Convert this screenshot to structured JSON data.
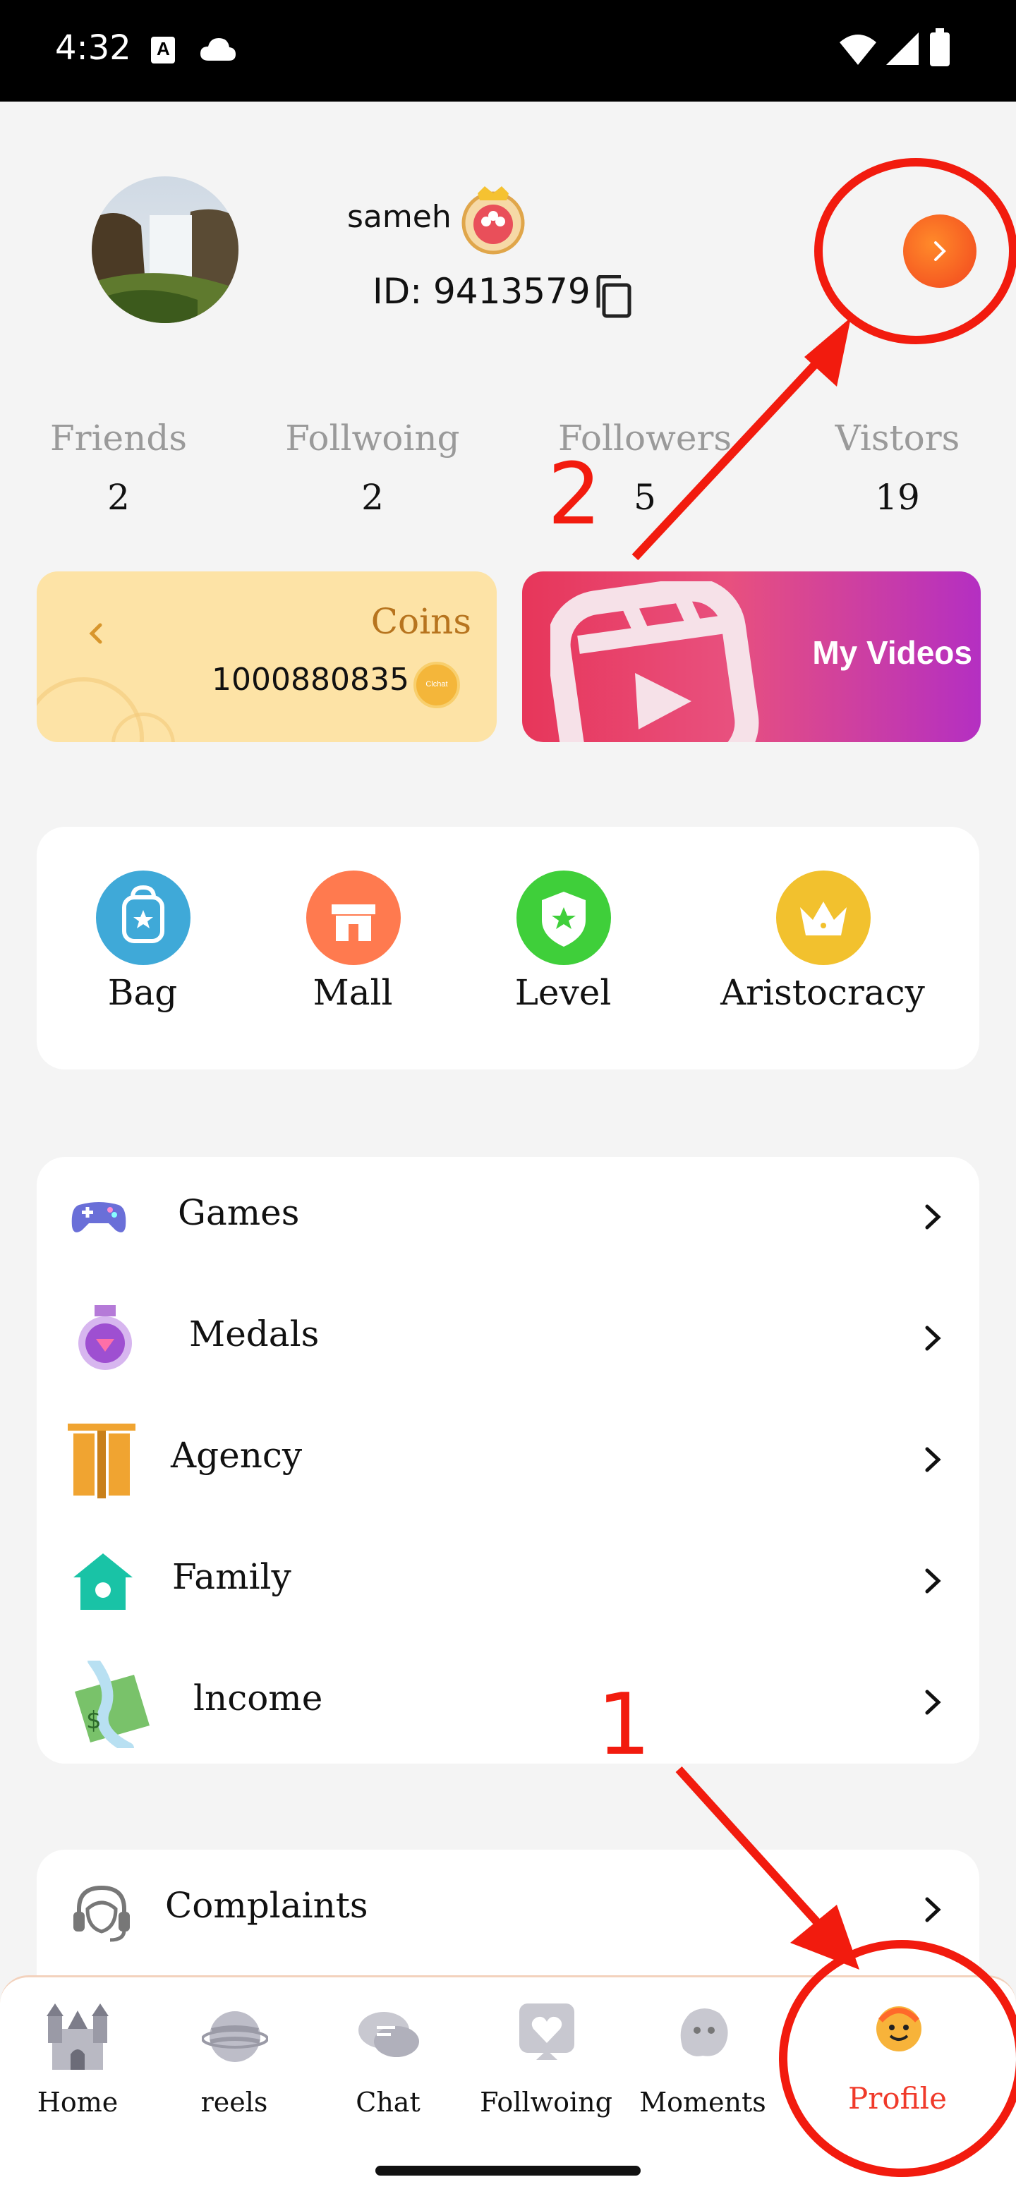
{
  "status_bar": {
    "time": "4:32"
  },
  "profile": {
    "username": "sameh",
    "id_text": "ID: 9413579"
  },
  "stats": [
    {
      "label": "Friends",
      "value": "2"
    },
    {
      "label": "Follwoing",
      "value": "2"
    },
    {
      "label": "Followers",
      "value": "5"
    },
    {
      "label": "Vistors",
      "value": "19"
    }
  ],
  "coins": {
    "title": "Coins",
    "amount": "1000880835",
    "coin_text": "Clchat"
  },
  "videos": {
    "label": "My Videos"
  },
  "quick_actions": [
    {
      "label": "Bag",
      "icon": "bag-icon",
      "color": "#3fa9d8"
    },
    {
      "label": "Mall",
      "icon": "shop-icon",
      "color": "#ff7a4f"
    },
    {
      "label": "Level",
      "icon": "shield-star-icon",
      "color": "#3fcf3a"
    },
    {
      "label": "Aristocracy",
      "icon": "crown-icon",
      "color": "#f2c12e"
    }
  ],
  "menu": [
    {
      "label": "Games",
      "icon": "gamepad-icon"
    },
    {
      "label": "Medals",
      "icon": "medal-icon"
    },
    {
      "label": "Agency",
      "icon": "agency-icon"
    },
    {
      "label": "Family",
      "icon": "house-icon"
    },
    {
      "label": "lncome",
      "icon": "money-icon"
    }
  ],
  "menu2": [
    {
      "label": "Complaints",
      "icon": "headset-icon"
    }
  ],
  "bottom_nav": [
    {
      "label": "Home",
      "icon": "castle-icon",
      "active": false
    },
    {
      "label": "reels",
      "icon": "planet-icon",
      "active": false
    },
    {
      "label": "Chat",
      "icon": "chat-bubbles-icon",
      "active": false
    },
    {
      "label": "Follwoing",
      "icon": "heart-icon",
      "active": false
    },
    {
      "label": "Moments",
      "icon": "moments-icon",
      "active": false
    },
    {
      "label": "Profile",
      "icon": "smiley-icon",
      "active": true
    }
  ],
  "annotations": {
    "step1": "1",
    "step2": "2"
  },
  "colors": {
    "accent": "#f03a2a",
    "annotation": "#f21b0e",
    "coins_bg": "#fde3a6",
    "coins_title": "#b7741e"
  }
}
